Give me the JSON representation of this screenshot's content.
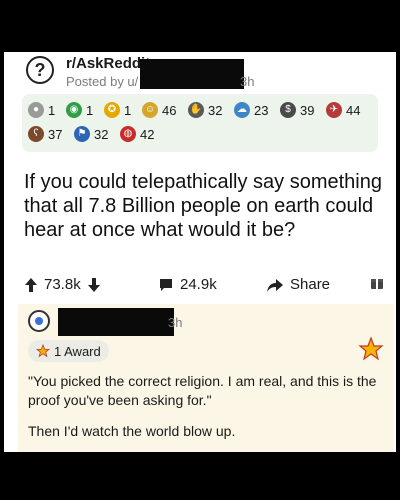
{
  "post": {
    "subreddit": "r/AskReddit",
    "posted_by": "Posted by u/",
    "age": "3h",
    "title": "If you could telepathically say something that all 7.8 Billion people on earth could hear at once what would it be?"
  },
  "awards": [
    {
      "icon": "silver-award-icon",
      "count": "1",
      "color": "#9a9a9a"
    },
    {
      "icon": "green-award-icon",
      "count": "1",
      "color": "#2f9e44"
    },
    {
      "icon": "gold-award-icon",
      "count": "1",
      "color": "#e6a700"
    },
    {
      "icon": "wholesome-award-icon",
      "count": "46",
      "color": "#d4a72c"
    },
    {
      "icon": "helpful-award-icon",
      "count": "32",
      "color": "#5a5a5a"
    },
    {
      "icon": "chat-award-icon",
      "count": "23",
      "color": "#3d87c9"
    },
    {
      "icon": "coin-award-icon",
      "count": "39",
      "color": "#4a4a4a"
    },
    {
      "icon": "rocket-award-icon",
      "count": "44",
      "color": "#b53a3a"
    },
    {
      "icon": "bear-award-icon",
      "count": "37",
      "color": "#7a4a2a"
    },
    {
      "icon": "flag-award-icon",
      "count": "32",
      "color": "#2e66b5"
    },
    {
      "icon": "globe-award-icon",
      "count": "42",
      "color": "#c92a2a"
    }
  ],
  "actions": {
    "upvotes": "73.8k",
    "comments": "24.9k",
    "share": "Share"
  },
  "comment": {
    "age": "3h",
    "award_label": "1 Award",
    "line1": "\"You picked the correct religion. I am real, and this is the proof you've been asking for.\"",
    "line2": "Then I'd watch the world blow up."
  }
}
